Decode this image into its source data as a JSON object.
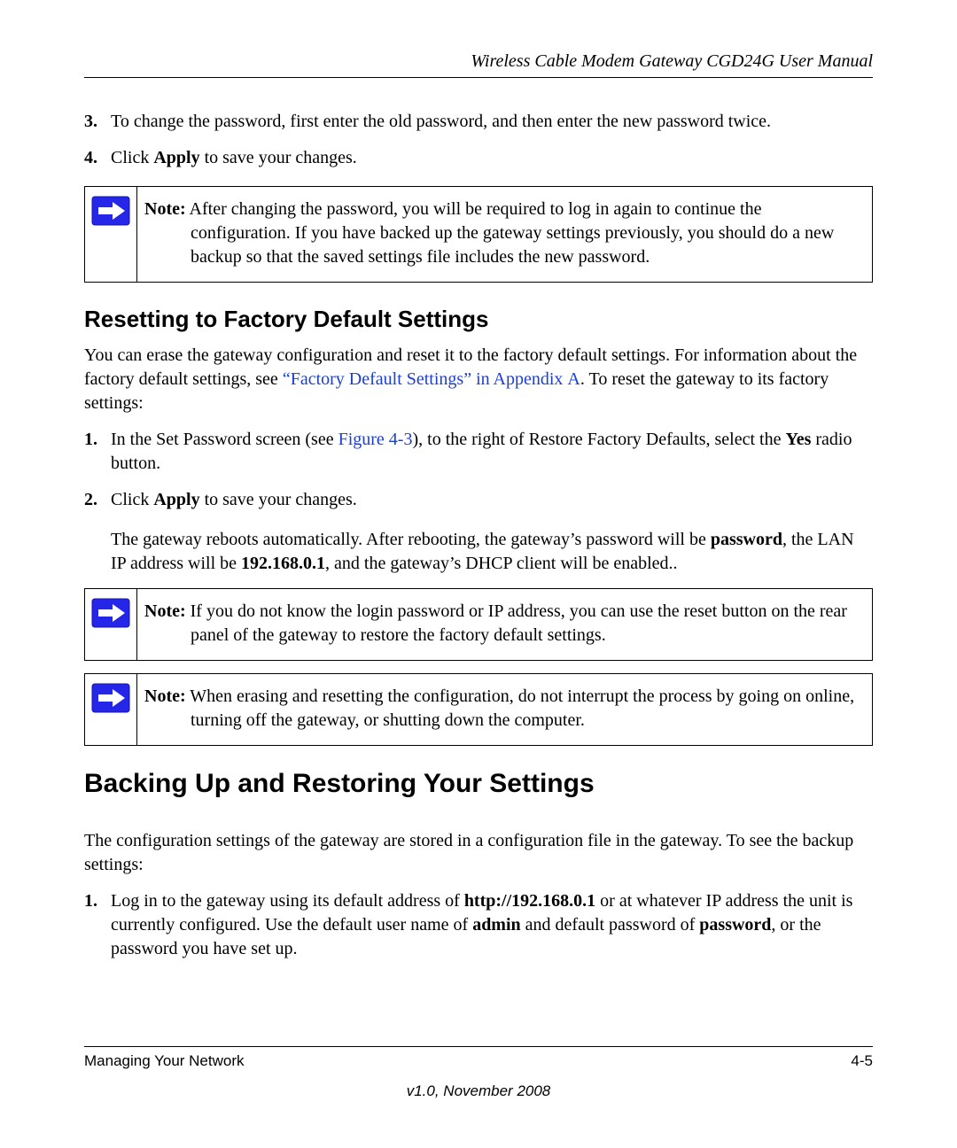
{
  "header": {
    "title": "Wireless Cable Modem Gateway CGD24G User Manual"
  },
  "topList": {
    "item3": {
      "num": "3.",
      "text": "To change the password, first enter the old password, and then enter the new password twice."
    },
    "item4": {
      "num": "4.",
      "prefix": "Click ",
      "bold": "Apply",
      "suffix": " to save your changes."
    }
  },
  "note1": {
    "label": "Note:",
    "text": " After changing the password, you will be required to log in again to continue the configuration. If you have backed up the gateway settings previously, you should do a new backup so that the saved settings file includes the new password."
  },
  "section1": {
    "heading": "Resetting to Factory Default Settings",
    "intro_pre": "You can erase the gateway configuration and reset it to the factory default settings. For information about the factory default settings, see ",
    "intro_link": "“Factory Default Settings” in Appendix A",
    "intro_post": ". To reset the gateway to its factory settings:"
  },
  "list2": {
    "item1": {
      "num": "1.",
      "pre": "In the Set Password screen (see ",
      "link": "Figure 4-3",
      "mid": "), to the right of Restore Factory Defaults, select the ",
      "bold": "Yes",
      "post": " radio button."
    },
    "item2": {
      "num": "2.",
      "pre": "Click ",
      "bold": "Apply",
      "post": " to save your changes."
    },
    "sub": {
      "t1": "The gateway reboots automatically. After rebooting, the gateway’s password will be ",
      "b1": "password",
      "t2": ", the LAN IP address will be ",
      "b2": "192.168.0.1",
      "t3": ", and the gateway’s DHCP client will be enabled.."
    }
  },
  "note2": {
    "label": "Note:",
    "text": " If you do not know the login password or IP address, you can use the reset button on the rear panel of the gateway to restore the factory default settings."
  },
  "note3": {
    "label": "Note:",
    "text": " When erasing and resetting the configuration, do not interrupt the process by going on online, turning off the gateway, or shutting down the computer."
  },
  "section2": {
    "heading": "Backing Up and Restoring Your Settings",
    "intro": "The configuration settings of the gateway are stored in a configuration file in the gateway. To see the backup settings:"
  },
  "list3": {
    "item1": {
      "num": "1.",
      "t1": "Log in to the gateway using its default address of ",
      "b1": "http://192.168.0.1",
      "t2": " or at whatever IP address the unit is currently configured. Use the default user name of ",
      "b2": "admin",
      "t3": " and default password of ",
      "b3": "password",
      "t4": ", or the password you have set up."
    }
  },
  "footer": {
    "left": "Managing Your Network",
    "right": "4-5",
    "version": "v1.0, November 2008"
  }
}
